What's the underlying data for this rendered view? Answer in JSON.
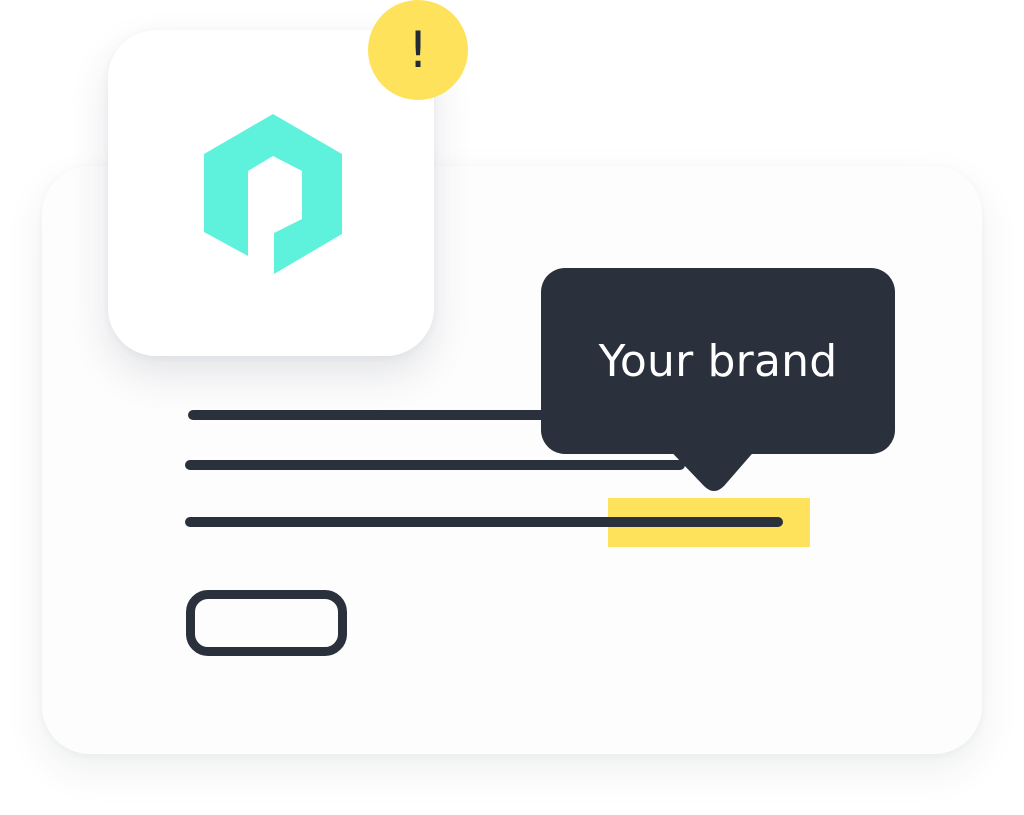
{
  "tooltip": {
    "label": "Your brand"
  },
  "alert": {
    "symbol": "!"
  },
  "icons": {
    "logo": "hexagon-logo-icon",
    "alert": "exclamation-icon"
  },
  "colors": {
    "logo": "#5ef2dd",
    "accent": "#ffe25b",
    "dark": "#2a303c",
    "card": "#fdfdfd"
  }
}
